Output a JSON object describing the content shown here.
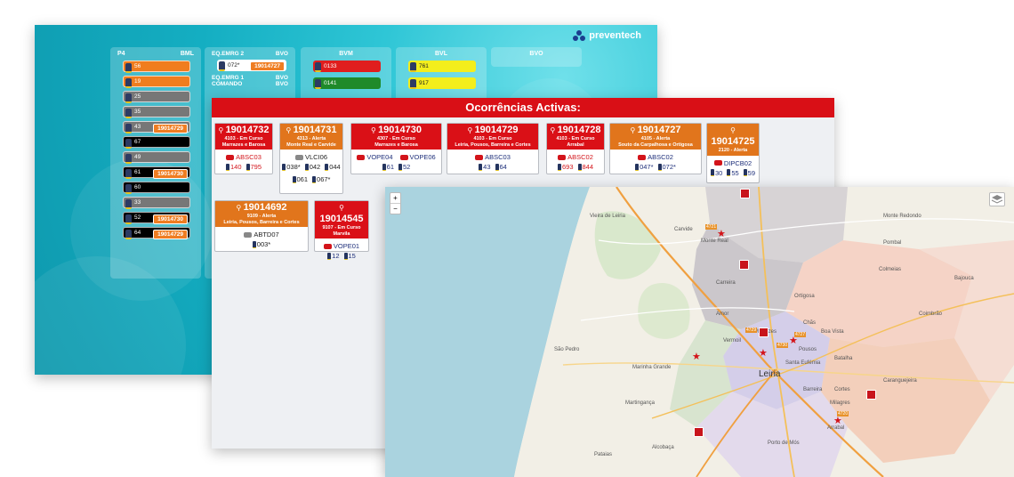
{
  "dashboard": {
    "logo_text": "preventech",
    "columns": [
      {
        "heads": [
          [
            "P4",
            "BML"
          ]
        ],
        "units": [
          {
            "label": "56",
            "color": "#f07d1e",
            "tag": ""
          },
          {
            "label": "19",
            "color": "#f07d1e",
            "tag": ""
          },
          {
            "label": "25",
            "color": "#777777",
            "tag": ""
          },
          {
            "label": "35",
            "color": "#777777",
            "tag": ""
          },
          {
            "label": "43",
            "color": "#777777",
            "tag": "19014729"
          },
          {
            "label": "67",
            "color": "#000000",
            "tag": ""
          },
          {
            "label": "49",
            "color": "#777777",
            "tag": ""
          },
          {
            "label": "61",
            "color": "#000000",
            "tag": "19014730"
          },
          {
            "label": "60",
            "color": "#000000",
            "tag": ""
          },
          {
            "label": "33",
            "color": "#777777",
            "tag": ""
          },
          {
            "label": "52",
            "color": "#000000",
            "tag": "19014730"
          },
          {
            "label": "64",
            "color": "#000000",
            "tag": "19014729"
          }
        ]
      }
    ],
    "col2": {
      "head_a_left": "EQ.EMRG 2",
      "head_a_right": "BVO",
      "unit_a_label": "072*",
      "unit_a_tag": "19014727",
      "head_b_left": "EQ.EMRG 1",
      "head_b_right": "BVO",
      "head_c_left": "COMANDO",
      "head_c_right": "BVO"
    },
    "col3": {
      "head": "BVM",
      "units": [
        {
          "label": "0133",
          "color": "#e01e1e"
        },
        {
          "label": "0141",
          "color": "#1f8a2a"
        }
      ]
    },
    "col4": {
      "head": "BVL",
      "units": [
        {
          "label": "761",
          "color": "#f3ee1c"
        },
        {
          "label": "917",
          "color": "#f3ee1c"
        }
      ]
    },
    "col5": {
      "head": "BVO"
    }
  },
  "occurrences": {
    "title": "Ocorrências Activas:",
    "cards": [
      {
        "num": "19014732",
        "l1": "4103 - Em Curso",
        "l2": "Marrazes e Barosa",
        "color": "red",
        "veh": [
          {
            "code": "ABSC03",
            "txt": "red"
          }
        ],
        "pers": [
          "140",
          "795"
        ],
        "pers_color": "red"
      },
      {
        "num": "19014731",
        "l1": "4313 - Alerta",
        "l2": "Monte Real e Carvide",
        "color": "orange",
        "veh": [
          {
            "code": "VLCI06",
            "txt": "black"
          }
        ],
        "pers": [
          "038*",
          "042",
          "044",
          "061",
          "067*"
        ],
        "pers_color": "black"
      },
      {
        "num": "19014730",
        "l1": "4307 - Em Curso",
        "l2": "Marrazes e Barosa",
        "color": "red",
        "veh": [
          {
            "code": "VOPE04",
            "txt": "blue"
          },
          {
            "code": "VOPE06",
            "txt": "blue"
          }
        ],
        "pers": [
          "61",
          "52"
        ],
        "pers_color": "blue"
      },
      {
        "num": "19014729",
        "l1": "4103 - Em Curso",
        "l2": "Leiria, Pousos, Barreira e Cortes",
        "color": "red",
        "veh": [
          {
            "code": "ABSC03",
            "txt": "blue"
          }
        ],
        "pers": [
          "43",
          "64"
        ],
        "pers_color": "blue"
      },
      {
        "num": "19014728",
        "l1": "4103 - Em Curso",
        "l2": "Arrabal",
        "color": "red",
        "veh": [
          {
            "code": "ABSC02",
            "txt": "red"
          }
        ],
        "pers": [
          "693",
          "844"
        ],
        "pers_color": "red"
      },
      {
        "num": "19014727",
        "l1": "4105 - Alerta",
        "l2": "Souto da Carpalhosa e Ortigosa",
        "color": "orange",
        "veh": [
          {
            "code": "ABSC02",
            "txt": "blue"
          }
        ],
        "pers": [
          "047*",
          "072*"
        ],
        "pers_color": "blue"
      },
      {
        "num": "19014725",
        "l1": "2120 - Alerta",
        "l2": "",
        "color": "orange",
        "veh": [
          {
            "code": "DIPCB02",
            "txt": "blue"
          }
        ],
        "pers": [
          "30",
          "55",
          "59"
        ],
        "pers_color": "blue"
      },
      {
        "num": "19014692",
        "l1": "9109 - Alerta",
        "l2": "Leiria, Pousos, Barreira e Cortes",
        "color": "orange",
        "veh": [
          {
            "code": "ABTD07",
            "txt": "black"
          }
        ],
        "pers": [
          "003*"
        ],
        "pers_color": "black"
      },
      {
        "num": "19014545",
        "l1": "9107 - Em Curso",
        "l2": "Marvila",
        "color": "red",
        "veh": [
          {
            "code": "VOPE01",
            "txt": "blue"
          }
        ],
        "pers": [
          "12",
          "15"
        ],
        "pers_color": "blue"
      }
    ]
  },
  "map": {
    "zoom_in": "+",
    "zoom_out": "−",
    "labels": [
      "Vieira de Leiria",
      "Monte Real",
      "Marinha Grande",
      "São Pedro",
      "Leiria",
      "Batalha",
      "Pombal",
      "Vermoil",
      "Santa Eufémia",
      "Caranguejeira",
      "Milagres",
      "Colmeias",
      "Chãs",
      "Boa Vista",
      "Arrabal",
      "Porto de Mós",
      "Alcobaça",
      "Ortigosa",
      "Carreira",
      "Monte Redondo",
      "Coimbrão",
      "Bajouca",
      "Carvide",
      "Cortes",
      "Pataias",
      "Martingança",
      "Amor",
      "Barreira",
      "Pousos",
      "Marrazes"
    ],
    "marker_codes": [
      "4721",
      "4729",
      "4730",
      "4720",
      "4727"
    ]
  }
}
